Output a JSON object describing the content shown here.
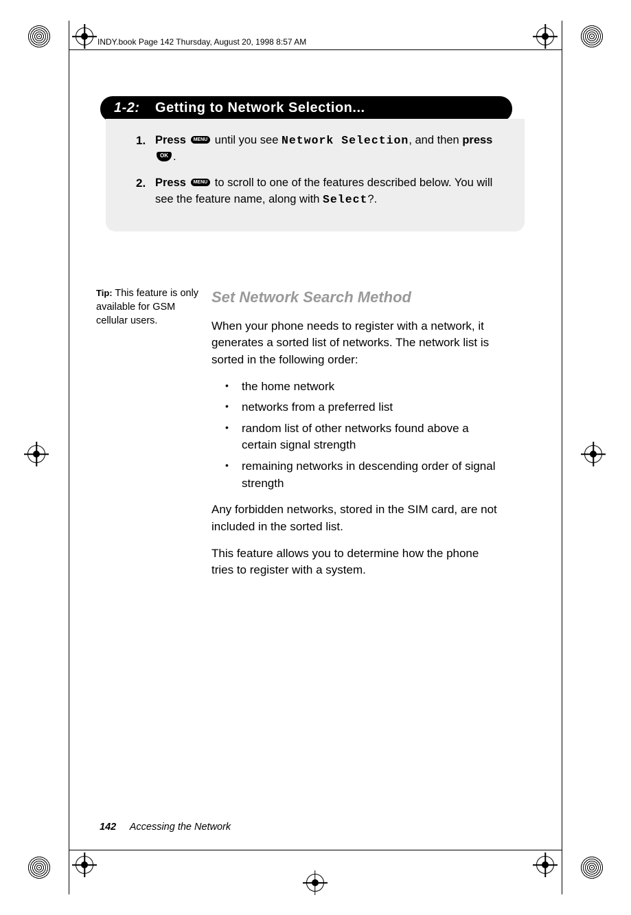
{
  "running_head": "INDY.book  Page 142  Thursday, August 20, 1998  8:57 AM",
  "section": {
    "number": "1-2:",
    "title": "Getting to Network Selection..."
  },
  "steps": [
    {
      "n": "1.",
      "press1": "Press",
      "key1": "MENU",
      "text1": " until you see ",
      "lcd1": "Network Selection",
      "text2": ", and then ",
      "press2": "press",
      "key2": "OK",
      "text3": "."
    },
    {
      "n": "2.",
      "press1": "Press",
      "key1": "MENU",
      "text1": " to scroll to one of the features described below. You will see the feature name, along with ",
      "lcd1": "Select",
      "text2": "?."
    }
  ],
  "tip": {
    "label": "Tip:",
    "text": " This feature is only available for GSM cellular users."
  },
  "subhead": "Set Network Search Method",
  "para1": "When your phone needs to register with a network, it generates a sorted list of networks. The network list is sorted in the following order:",
  "bullets": [
    "the home network",
    "networks from a preferred list",
    "random list of other networks found above a certain signal strength",
    "remaining networks in descending order of signal strength"
  ],
  "para2": "Any forbidden networks, stored in the SIM card, are not included in the sorted list.",
  "para3": "This feature allows you to determine how the phone tries to register with a system.",
  "footer": {
    "page": "142",
    "label": "Accessing the Network"
  }
}
